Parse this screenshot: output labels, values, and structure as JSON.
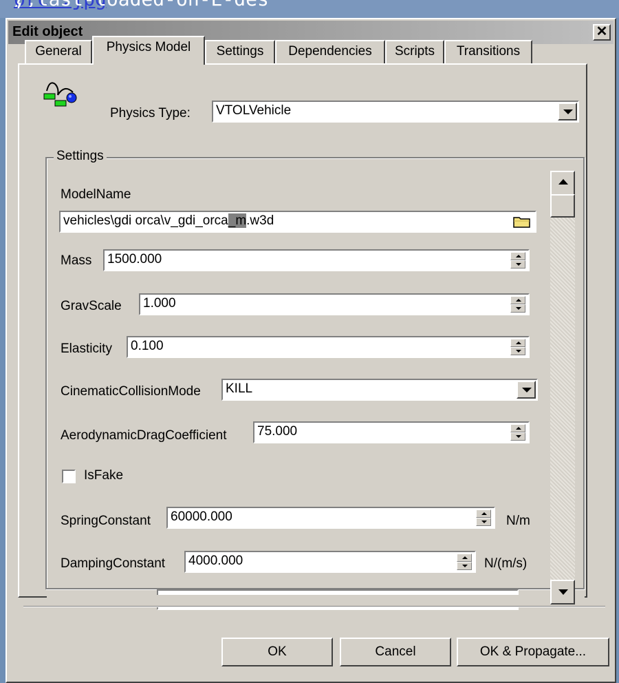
{
  "background_caption": {
    "prefix": "/,",
    "link": "orca.jpg",
    "suffix": ", last-loaded-on-E-des"
  },
  "dialog": {
    "title": "Edit object",
    "close_glyph": "✕"
  },
  "tabs": [
    {
      "label": "General",
      "active": false
    },
    {
      "label": "Physics Model",
      "active": true
    },
    {
      "label": "Settings",
      "active": false
    },
    {
      "label": "Dependencies",
      "active": false
    },
    {
      "label": "Scripts",
      "active": false
    },
    {
      "label": "Transitions",
      "active": false
    }
  ],
  "physics_type": {
    "label": "Physics Type:",
    "value": "VTOLVehicle",
    "icon": "physics-model-icon"
  },
  "settings_group": {
    "label": "Settings",
    "model_name": {
      "label": "ModelName",
      "value_pre": "vehicles\\gdi orca\\v_gdi_orca",
      "value_sel": "_m",
      "value_post": ".w3d",
      "icon": "folder-icon"
    },
    "mass": {
      "label": "Mass",
      "value": "1500.000"
    },
    "grav_scale": {
      "label": "GravScale",
      "value": "1.000"
    },
    "elasticity": {
      "label": "Elasticity",
      "value": "0.100"
    },
    "cinematic_mode": {
      "label": "CinematicCollisionMode",
      "value": "KILL"
    },
    "aero_drag": {
      "label": "AerodynamicDragCoefficient",
      "value": "75.000"
    },
    "is_fake": {
      "label": "IsFake",
      "checked": false
    },
    "spring_constant": {
      "label": "SpringConstant",
      "value": "60000.000",
      "unit": "N/m"
    },
    "damping_constant": {
      "label": "DampingConstant",
      "value": "4000.000",
      "unit": "N/(m/s)"
    }
  },
  "buttons": {
    "ok": "OK",
    "cancel": "Cancel",
    "ok_propagate": "OK & Propagate..."
  },
  "colors": {
    "desktop": "#6f8fb5",
    "dialog_face": "#d4d0c8",
    "title_gradient_start": "#808080",
    "title_gradient_end": "#c0c0c0"
  }
}
